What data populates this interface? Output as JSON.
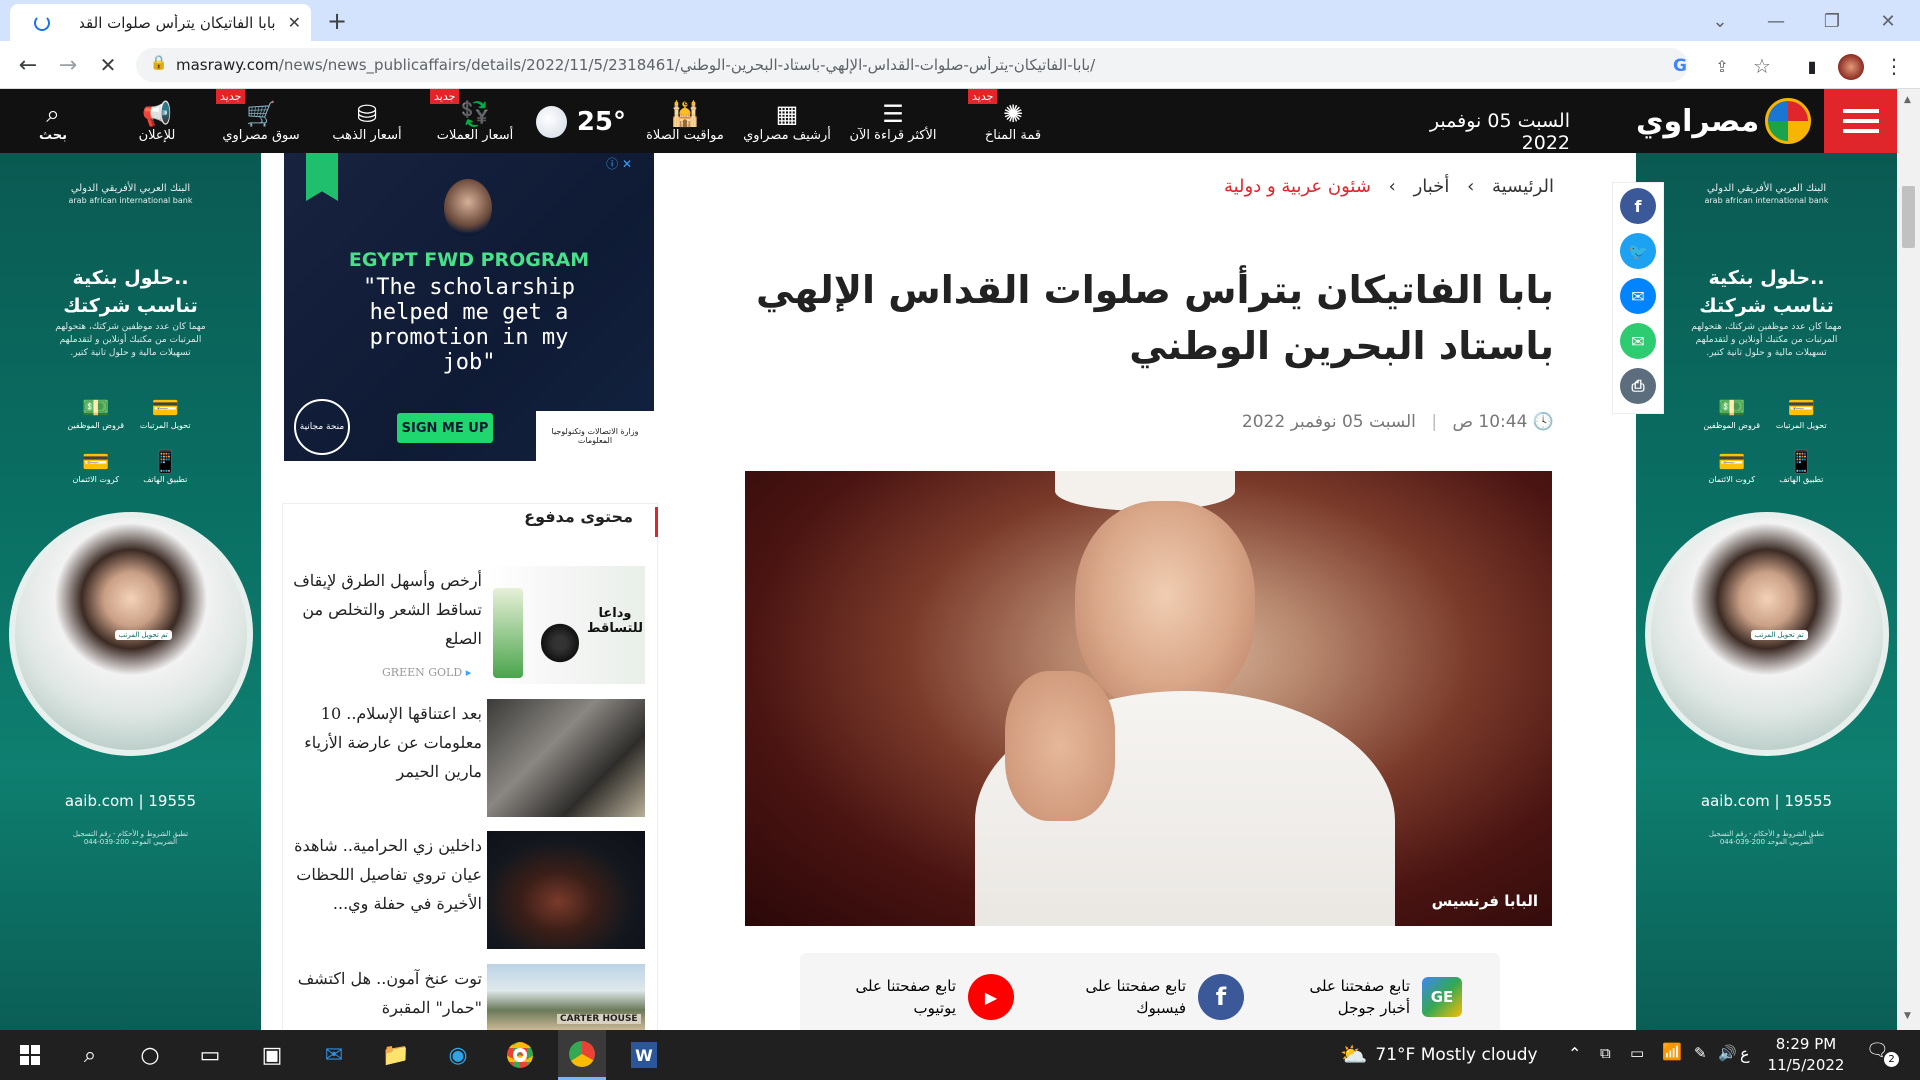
{
  "browser": {
    "tab_title": "بابا الفاتيكان يترأس صلوات القداس",
    "url_domain": "masrawy.com",
    "url_path": "/news/news_publicaffairs/details/2022/11/5/2318461/بابا-الفاتيكان-يترأس-صلوات-القداس-الإلهي-باستاد-البحرين-الوطني/"
  },
  "site": {
    "logo_text": "مصراوي",
    "date": "السبت 05 نوفمبر 2022",
    "nav": [
      {
        "label": "قمة المناخ",
        "badge": "جديد"
      },
      {
        "label": "الأكثر قراءة الآن",
        "badge": ""
      },
      {
        "label": "أرشيف مصراوي",
        "badge": ""
      },
      {
        "label": "مواقيت الصلاة",
        "badge": ""
      },
      {
        "label": "أسعار العملات",
        "badge": "جديد"
      },
      {
        "label": "أسعار الذهب",
        "badge": ""
      },
      {
        "label": "سوق مصراوي",
        "badge": "جديد"
      },
      {
        "label": "للإعلان",
        "badge": ""
      },
      {
        "label": "بحث",
        "badge": ""
      }
    ],
    "temperature": "25°"
  },
  "breadcrumb": {
    "home": "الرئيسية",
    "news": "أخبار",
    "section": "شئون عربية و دولية"
  },
  "article": {
    "title": "بابا الفاتيكان يترأس صلوات القداس الإلهي باستاد البحرين الوطني",
    "time": "10:44 ص",
    "date": "السبت 05 نوفمبر 2022",
    "image_caption": "البابا فرنسيس"
  },
  "follow": {
    "google": "تابع صفحتنا على أخبار جوجل",
    "facebook": "تابع صفحتنا على فيسبوك",
    "youtube": "تابع صفحتنا على يوتيوب"
  },
  "sidebar_ad": {
    "program": "EGYPT FWD PROGRAM",
    "quote": "\"The scholarship helped me get a promotion in my job\"",
    "cta": "SIGN ME UP",
    "ministry": "وزارة الاتصالات وتكنولوجيا المعلومات",
    "badge": "منحة مجانية"
  },
  "paid_content": {
    "heading": "محتوى مدفوع",
    "items": [
      {
        "text": "أرخص وأسهل الطرق لإيقاف تساقط الشعر والتخلص من الصلع",
        "source": "GREEN GOLD",
        "img_text": "وداعا للتساقط"
      },
      {
        "text": "بعد اعتناقها الإسلام.. 10 معلومات عن عارضة الأزياء مارين الحيمر",
        "source": "",
        "img_text": ""
      },
      {
        "text": "داخلين زي الحرامية.. شاهدة عيان تروي تفاصيل اللحظات الأخيرة في حفلة وي...",
        "source": "",
        "img_text": ""
      },
      {
        "text": "توت عنخ آمون.. هل اكتشف \"حمار\" المقبرة",
        "source": "",
        "img_text": "CARTER HOUSE"
      }
    ]
  },
  "bank_ad": {
    "bank_name": "البنك العربي الأفريقي الدولي",
    "bank_name_en": "arab african international bank",
    "headline1": "حلول بنكية..",
    "headline2": "تناسب شركتك",
    "body": "مهما كان عدد موظفين شركتك، هتحولهم المرتبات من مكتبك أونلاين و لتقدملهم تسهيلات مالية و حلول تانية كتير.",
    "services": [
      "تحويل المرتبات",
      "قروض الموظفين",
      "تطبيق الهاتف",
      "كروت الائتمان"
    ],
    "phone_tag": "تم تحويل المرتب",
    "contact": "aaib.com | 19555",
    "footer": "تطبق الشروط و الأحكام - رقم التسجيل الضريبي الموحد 200-039-044"
  },
  "taskbar": {
    "weather": "71°F  Mostly cloudy",
    "lang": "ع",
    "time": "8:29 PM",
    "date": "11/5/2022",
    "notifications": "2"
  },
  "colors": {
    "accent_red": "#e0262b",
    "nav_bg": "#111111",
    "bank_green": "#0a6f63",
    "facebook": "#3b5998",
    "twitter": "#1da1f2",
    "messenger": "#0084ff",
    "email": "#2ecc71",
    "print": "#5c6d7e",
    "youtube": "#ff0000"
  }
}
